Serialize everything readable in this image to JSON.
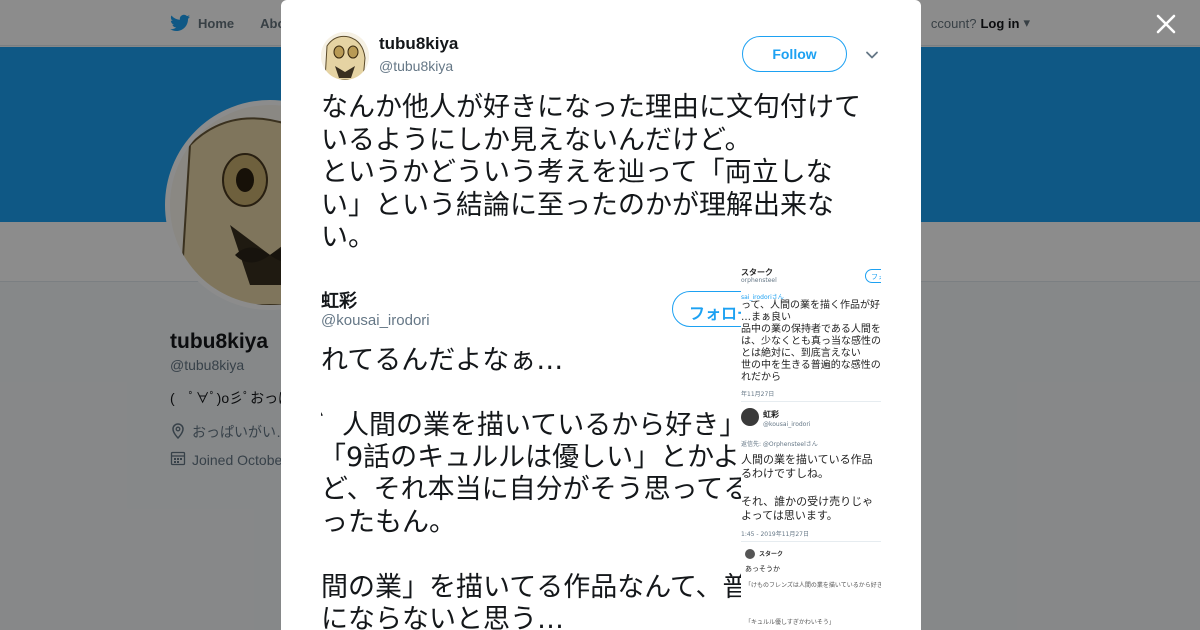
{
  "topbar": {
    "home_label": "Home",
    "about_label": "Abo",
    "account_prompt": "ccount?",
    "login_label": "Log in"
  },
  "profile": {
    "name": "tubu8kiya",
    "handle": "@tubu8kiya",
    "bio": "(　ﾟ∀ﾟ)o彡ﾟおっぱ",
    "location": "おっぱいがい…",
    "joined": "Joined Octobe"
  },
  "tweet": {
    "author_name": "tubu8kiya",
    "author_handle": "@tubu8kiya",
    "follow_label": "Follow",
    "text": "なんか他人が好きになった理由に文句付けて\nいるようにしか見えないんだけど。\nというかどういう考えを辿って「両立しな\nい」という結論に至ったのかが理解出来な\nい。"
  },
  "embedded": {
    "name": "虹彩",
    "handle": "@kousai_irodori",
    "follow_label": "フォロー",
    "text_lines": [
      "れてるんだよなぁ…",
      "",
      "゛人間の業を描いているから好き」",
      "「9話のキュルルは優しい」とかよ",
      "ど、それ本当に自分がそう思ってる",
      "ったもん。",
      "",
      "間の業」を描いてる作品なんて、普",
      "にならないと思う…"
    ],
    "right_panel": {
      "header_name": "スターク",
      "header_handle": "orphensteel",
      "follow_label": "フォ",
      "reply_to": "sai_irodoriさん",
      "lines_top": [
        "って、人間の業を描く作品が好",
        "…まぁ良い",
        "品中の業の保持者である人間を",
        "は、少なくとも真っ当な感性の",
        "とは絶対に、到底言えない",
        "世の中を生きる普遍的な感性の",
        "れだから"
      ],
      "date_top": "年11月27日",
      "reply_name": "虹彩",
      "reply_handle": "@kousai_irodori",
      "reply_to2": "返信先: @Orphensteelさん",
      "lines_mid": [
        "人間の業を描いている作品",
        "るわけですしね。",
        "",
        "それ、誰かの受け売りじゃ",
        "よっては思います。"
      ],
      "date_mid": "1:45 - 2019年11月27日",
      "bottom_name": "スターク",
      "bottom_text": "あっそうか",
      "bottom_line2": "「けものフレンズは人間の業を描いているから好き」",
      "bottom_line3": "「キュルル優しすぎかわいそう」"
    }
  }
}
